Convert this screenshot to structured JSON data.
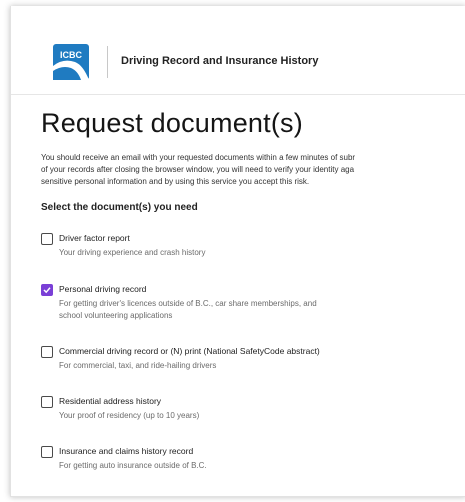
{
  "header": {
    "logo_text": "ICBC",
    "title": "Driving Record and Insurance History"
  },
  "page": {
    "title": "Request document(s)",
    "intro_lines": [
      "You should receive an email with your requested documents within a few minutes of subr",
      "of your records after closing the browser window, you will need to verify your identity aga",
      "sensitive personal information and by using this service you accept this risk."
    ],
    "section_label": "Select the document(s) you need"
  },
  "options": [
    {
      "label": "Driver factor report",
      "desc": [
        "Your driving experience and crash history"
      ],
      "checked": false
    },
    {
      "label": "Personal driving record",
      "desc": [
        "For getting driver's licences outside of B.C., car share memberships, and",
        "school volunteering applications"
      ],
      "checked": true
    },
    {
      "label": "Commercial driving record or (N) print (National SafetyCode abstract)",
      "desc": [
        "For commercial, taxi, and ride-hailing drivers"
      ],
      "checked": false
    },
    {
      "label": "Residential address history",
      "desc": [
        "Your proof of residency (up to 10 years)"
      ],
      "checked": false
    },
    {
      "label": "Insurance and claims history record",
      "desc": [
        "For getting auto insurance outside of B.C."
      ],
      "checked": false
    }
  ],
  "colors": {
    "logo_blue": "#1f7bc1",
    "checkbox_accent": "#7a3fd6"
  }
}
